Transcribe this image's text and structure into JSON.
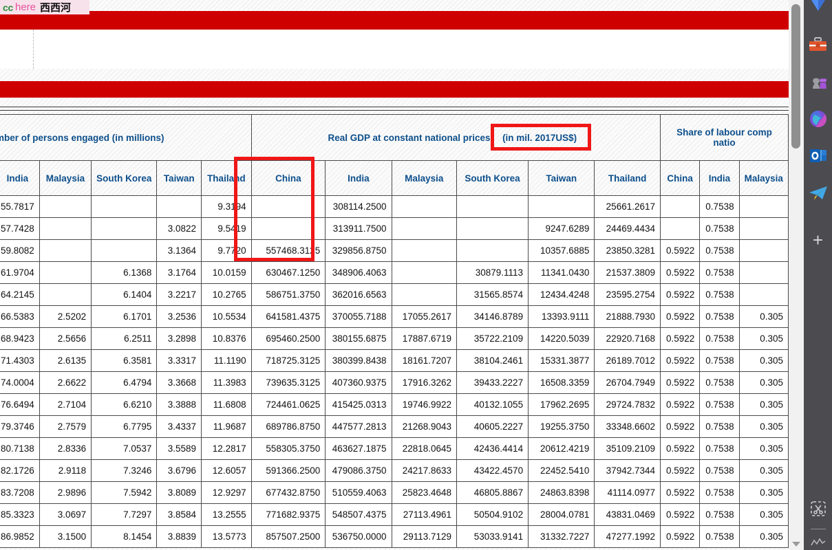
{
  "watermark": {
    "cc": "cc",
    "here": "here",
    "site": "西西河"
  },
  "annotations": {
    "unit_box_label": "(in mil. 2017US$)",
    "china_column_box_label": "China"
  },
  "table": {
    "groups": [
      {
        "label": "mber of persons engaged (in millions)",
        "span": 5
      },
      {
        "label": "Real GDP at constant national prices (in mil. 2017US$)",
        "span": 6
      },
      {
        "label": "Share of labour compensation ... national",
        "span": 3
      }
    ],
    "columns": [
      "India",
      "Malaysia",
      "South Korea",
      "Taiwan",
      "Thailand",
      "China",
      "India",
      "Malaysia",
      "South Korea",
      "Taiwan",
      "Thailand",
      "China",
      "India",
      "Malaysia"
    ],
    "rows": [
      [
        "55.7817",
        "",
        "",
        "",
        "9.3194",
        "",
        "308114.2500",
        "",
        "",
        "",
        "25661.2617",
        "",
        "0.7538",
        ""
      ],
      [
        "57.7428",
        "",
        "",
        "3.0822",
        "9.5419",
        "",
        "313911.7500",
        "",
        "",
        "9247.6289",
        "24469.4434",
        "",
        "0.7538",
        ""
      ],
      [
        "59.8082",
        "",
        "",
        "3.1364",
        "9.7720",
        "557468.3125",
        "329856.8750",
        "",
        "",
        "10357.6885",
        "23850.3281",
        "0.5922",
        "0.7538",
        ""
      ],
      [
        "61.9704",
        "",
        "6.1368",
        "3.1764",
        "10.0159",
        "630467.1250",
        "348906.4063",
        "",
        "30879.1113",
        "11341.0430",
        "21537.3809",
        "0.5922",
        "0.7538",
        ""
      ],
      [
        "64.2145",
        "",
        "6.1404",
        "3.2217",
        "10.2765",
        "586751.3750",
        "362016.6563",
        "",
        "31565.8574",
        "12434.4248",
        "23595.2754",
        "0.5922",
        "0.7538",
        ""
      ],
      [
        "66.5383",
        "2.5202",
        "6.1701",
        "3.2536",
        "10.5534",
        "641581.4375",
        "370055.7188",
        "17055.2617",
        "34146.8789",
        "13393.9111",
        "21888.7930",
        "0.5922",
        "0.7538",
        "0.305"
      ],
      [
        "68.9423",
        "2.5656",
        "6.2511",
        "3.2898",
        "10.8376",
        "695460.2500",
        "380155.6875",
        "17887.6719",
        "35722.2109",
        "14220.5039",
        "22920.7168",
        "0.5922",
        "0.7538",
        "0.305"
      ],
      [
        "71.4303",
        "2.6135",
        "6.3581",
        "3.3317",
        "11.1190",
        "718725.3125",
        "380399.8438",
        "18161.7207",
        "38104.2461",
        "15331.3877",
        "26189.7012",
        "0.5922",
        "0.7538",
        "0.305"
      ],
      [
        "74.0004",
        "2.6622",
        "6.4794",
        "3.3668",
        "11.3983",
        "739635.3125",
        "407360.9375",
        "17916.3262",
        "39433.2227",
        "16508.3359",
        "26704.7949",
        "0.5922",
        "0.7538",
        "0.305"
      ],
      [
        "76.6494",
        "2.7104",
        "6.6210",
        "3.3888",
        "11.6808",
        "724461.0625",
        "415425.0313",
        "19746.9922",
        "40132.1055",
        "17962.2695",
        "29724.7832",
        "0.5922",
        "0.7538",
        "0.305"
      ],
      [
        "79.3746",
        "2.7579",
        "6.7795",
        "3.4337",
        "11.9687",
        "689786.8750",
        "447577.2813",
        "21268.9043",
        "40605.2227",
        "19255.3750",
        "33348.6602",
        "0.5922",
        "0.7538",
        "0.305"
      ],
      [
        "80.7138",
        "2.8336",
        "7.0537",
        "3.5589",
        "12.2817",
        "558305.3750",
        "463627.1875",
        "22818.0645",
        "42436.4414",
        "20612.4219",
        "35109.2109",
        "0.5922",
        "0.7538",
        "0.305"
      ],
      [
        "82.1726",
        "2.9118",
        "7.3246",
        "3.6796",
        "12.6057",
        "591366.2500",
        "479086.3750",
        "24217.8633",
        "43422.4570",
        "22452.5410",
        "37942.7344",
        "0.5922",
        "0.7538",
        "0.305"
      ],
      [
        "83.7208",
        "2.9896",
        "7.5942",
        "3.8089",
        "12.9297",
        "677432.8750",
        "510559.4063",
        "25823.4648",
        "46805.8867",
        "24863.8398",
        "41114.0977",
        "0.5922",
        "0.7538",
        "0.305"
      ],
      [
        "85.3323",
        "3.0697",
        "7.7297",
        "3.8584",
        "13.2555",
        "771682.9375",
        "548507.4375",
        "27113.4961",
        "50504.9102",
        "28004.0781",
        "43831.0469",
        "0.5922",
        "0.7538",
        "0.305"
      ],
      [
        "86.9852",
        "3.1500",
        "8.1454",
        "3.8839",
        "13.5773",
        "857507.2500",
        "536750.0000",
        "29113.7129",
        "53033.9141",
        "31332.7227",
        "47277.1992",
        "0.5922",
        "0.7538",
        "0.305"
      ]
    ]
  },
  "sidebar": {
    "items": [
      {
        "name": "edge-copilot-icon",
        "label": "Copilot"
      },
      {
        "name": "toolbox-icon",
        "label": "Tools"
      },
      {
        "name": "chess-icon",
        "label": "Games"
      },
      {
        "name": "microsoft-365-icon",
        "label": "Microsoft 365"
      },
      {
        "name": "outlook-icon",
        "label": "Outlook"
      },
      {
        "name": "telegram-icon",
        "label": "Telegram"
      },
      {
        "name": "add-app-icon",
        "label": "+"
      },
      {
        "name": "snip-icon",
        "label": "Screenshot"
      }
    ]
  },
  "colors": {
    "banner_red": "#cf0000",
    "annotation_red": "#f01717",
    "header_blue": "#0d4f8b",
    "sidebar_bg": "#4b4b50"
  }
}
